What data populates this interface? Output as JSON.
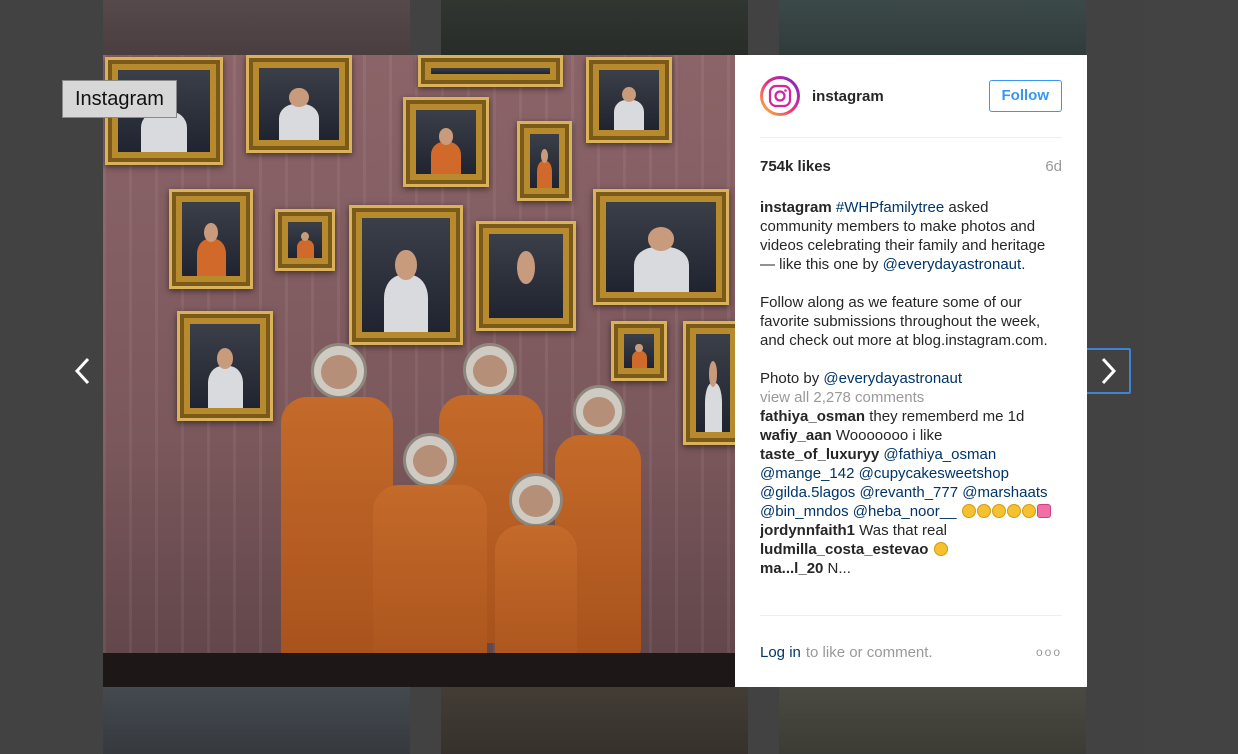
{
  "tooltip": {
    "text": "Instagram"
  },
  "post": {
    "username": "instagram",
    "follow_label": "Follow",
    "likes": "754k likes",
    "age": "6d",
    "caption": {
      "user": "instagram",
      "hashtag": "#WHPfamilytree",
      "text_1": " asked community members to make photos and videos celebrating their family and heritage — like this one by ",
      "mention": "@everydayastronaut",
      "text_2": ".",
      "paragraph_2": "Follow along as we feature some of our favorite submissions throughout the week, and check out more at blog.instagram.com.",
      "photo_by_label": "Photo by ",
      "photo_by_mention": "@everydayastronaut"
    },
    "view_all_comments": "view all 2,278 comments",
    "comments": [
      {
        "user": "fathiya_osman",
        "text": " they rememberd me 1d"
      },
      {
        "user": "wafiy_aan",
        "text": " Wooooooo i like"
      },
      {
        "user": "taste_of_luxuryy",
        "mentions": "@fathiya_osman @mange_142 @cupycakesweetshop @gilda.5lagos @revanth_777 @marshaats @bin_mndos @heba_noor__"
      },
      {
        "user": "jordynnfaith1",
        "text": " Was that real"
      },
      {
        "user": "ludmilla_costa_estevao",
        "text": ""
      },
      {
        "user": "ma...l_20",
        "text": " N..."
      }
    ],
    "footer": {
      "login": "Log in",
      "prompt": " to like or comment.",
      "more": "ooo"
    }
  },
  "icons": {
    "prev": "chevron-left-icon",
    "next": "chevron-right-icon",
    "avatar": "instagram-logo-icon"
  },
  "colors": {
    "accent": "#3897f0",
    "link": "#003569",
    "muted": "#999999",
    "focus": "#3d84d1"
  }
}
